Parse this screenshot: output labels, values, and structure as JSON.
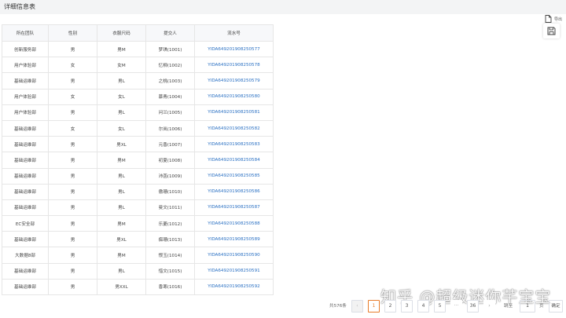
{
  "header": {
    "title": "详细信息表"
  },
  "toolbar": {
    "export_label": "导出",
    "save_icon": "save-icon"
  },
  "table": {
    "columns": [
      "所在团队",
      "性别",
      "衣服尺码",
      "提交人",
      "流水号"
    ],
    "rows": [
      [
        "创新服务部",
        "男",
        "男M",
        "梦琪(1001)",
        "YIDA649201908250577"
      ],
      [
        "用户体验部",
        "女",
        "女M",
        "忆柳(1002)",
        "YIDA649201908250578"
      ],
      [
        "基础运维部",
        "男",
        "男L",
        "之桃(1003)",
        "YIDA649201908250579"
      ],
      [
        "用户体验部",
        "女",
        "女L",
        "慕青(1004)",
        "YIDA649201908250580"
      ],
      [
        "用户体验部",
        "男",
        "男L",
        "问兰(1005)",
        "YIDA649201908250581"
      ],
      [
        "基础运维部",
        "女",
        "女L",
        "尔岚(1006)",
        "YIDA649201908250582"
      ],
      [
        "基础运维部",
        "男",
        "男XL",
        "元香(1007)",
        "YIDA649201908250583"
      ],
      [
        "基础运维部",
        "男",
        "男M",
        "初夏(1008)",
        "YIDA649201908250584"
      ],
      [
        "基础运维部",
        "男",
        "男L",
        "沛菡(1009)",
        "YIDA649201908250585"
      ],
      [
        "基础运维部",
        "男",
        "男L",
        "傲珊(1010)",
        "YIDA649201908250586"
      ],
      [
        "基础运维部",
        "男",
        "男L",
        "曼文(1011)",
        "YIDA649201908250587"
      ],
      [
        "EC安全部",
        "男",
        "男M",
        "乐菱(1012)",
        "YIDA649201908250588"
      ],
      [
        "基础运维部",
        "男",
        "男XL",
        "痴珊(1013)",
        "YIDA649201908250589"
      ],
      [
        "大数据8部",
        "男",
        "男M",
        "恨玉(1014)",
        "YIDA649201908250590"
      ],
      [
        "基础运维部",
        "男",
        "男L",
        "惜文(1015)",
        "YIDA649201908250591"
      ],
      [
        "基础运维部",
        "男",
        "男XXL",
        "香寒(1016)",
        "YIDA649201908250592"
      ]
    ]
  },
  "pagination": {
    "total": "共576条",
    "prev": "‹",
    "pages": [
      "1",
      "2",
      "3",
      "4",
      "5"
    ],
    "ellipsis": "···",
    "last": "36",
    "next": "›",
    "current_page": 1,
    "jump_label": "跳至",
    "jump_value": "1",
    "page_unit": "页",
    "confirm": "确定"
  },
  "watermark": "知乎 @超级迷你芊宝宝",
  "colors": {
    "accent": "#e87d2c",
    "link": "#2a70c3",
    "header_bg": "#f3f4f5",
    "border": "#e6e6e6"
  }
}
